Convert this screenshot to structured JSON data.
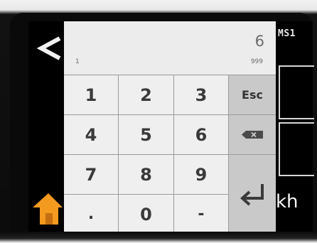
{
  "header": {
    "corner_label": "MS1"
  },
  "background": {
    "side_text": "kh"
  },
  "keypad": {
    "display": {
      "value": "6",
      "min": "1",
      "max": "999"
    },
    "keys": {
      "k1": "1",
      "k2": "2",
      "k3": "3",
      "k4": "4",
      "k5": "5",
      "k6": "6",
      "k7": "7",
      "k8": "8",
      "k9": "9",
      "dot": ".",
      "k0": "0",
      "minus": "-",
      "esc": "Esc"
    },
    "icons": {
      "back": "back-arrow-icon",
      "home": "home-icon",
      "backspace": "backspace-icon",
      "enter": "enter-icon"
    }
  },
  "colors": {
    "home_icon": "#f39a1f",
    "func_key_bg": "#c9c9c9",
    "key_bg": "#efefef"
  }
}
